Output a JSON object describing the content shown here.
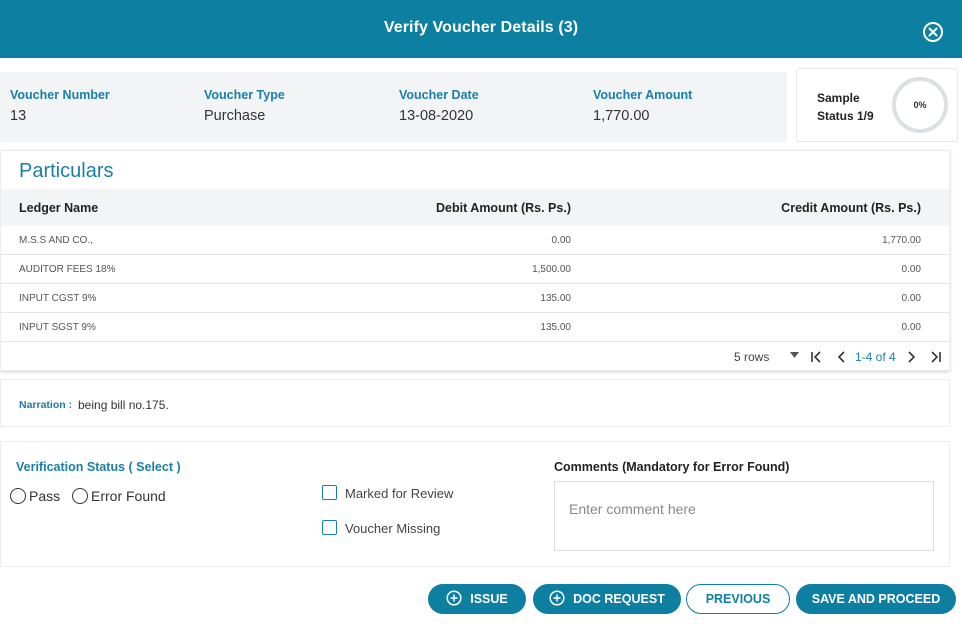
{
  "header": {
    "title": "Verify Voucher Details (3)"
  },
  "voucher": {
    "number_label": "Voucher Number",
    "number": "13",
    "type_label": "Voucher Type",
    "type": "Purchase",
    "date_label": "Voucher Date",
    "date": "13-08-2020",
    "amount_label": "Voucher Amount",
    "amount": "1,770.00"
  },
  "sample": {
    "label_line1": "Sample",
    "label_line2": "Status 1/9",
    "percent": "0%",
    "progress": 0
  },
  "particulars": {
    "title": "Particulars",
    "columns": {
      "ledger": "Ledger Name",
      "debit": "Debit Amount (Rs. Ps.)",
      "credit": "Credit Amount (Rs. Ps.)"
    },
    "rows": [
      {
        "ledger": "M.S.S AND CO.,",
        "debit": "0.00",
        "credit": "1,770.00"
      },
      {
        "ledger": "AUDITOR FEES 18%",
        "debit": "1,500.00",
        "credit": "0.00"
      },
      {
        "ledger": "INPUT CGST 9%",
        "debit": "135.00",
        "credit": "0.00"
      },
      {
        "ledger": "INPUT SGST 9%",
        "debit": "135.00",
        "credit": "0.00"
      }
    ],
    "pager": {
      "rows_per_page": "5 rows",
      "range": "1-4 of 4"
    }
  },
  "narration": {
    "label": "Narration :",
    "text": "being bill no.175."
  },
  "verification": {
    "title": "Verification Status ( Select )",
    "pass": "Pass",
    "error_found": "Error Found",
    "marked_for_review": "Marked for Review",
    "voucher_missing": "Voucher Missing",
    "comments_label": "Comments (Mandatory for Error Found)",
    "comments_placeholder": "Enter comment here"
  },
  "buttons": {
    "issue": "ISSUE",
    "doc_request": "DOC REQUEST",
    "previous": "PREVIOUS",
    "save": "SAVE AND PROCEED"
  },
  "colors": {
    "primary": "#0d7fa0",
    "label": "#1a7fa6",
    "panel": "#f2f4f6"
  }
}
